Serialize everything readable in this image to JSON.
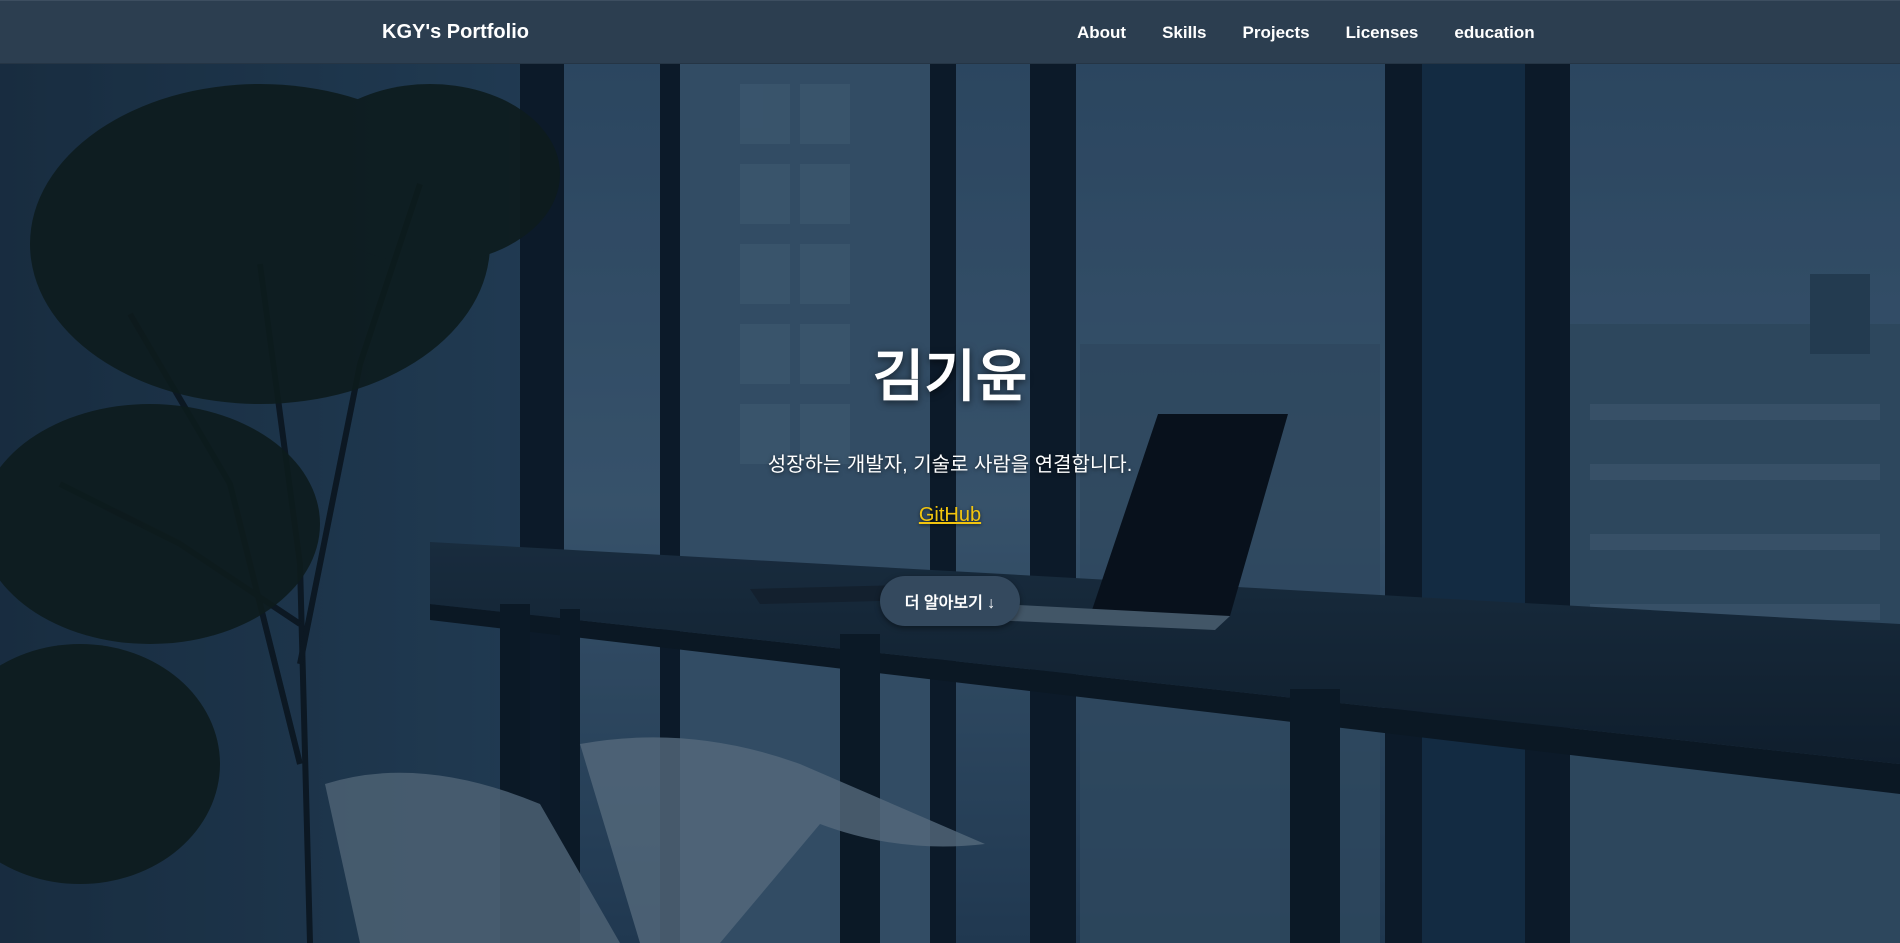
{
  "nav": {
    "brand": "KGY's Portfolio",
    "items": [
      {
        "label": "About"
      },
      {
        "label": "Skills"
      },
      {
        "label": "Projects"
      },
      {
        "label": "Licenses"
      },
      {
        "label": "education"
      }
    ]
  },
  "hero": {
    "title": "김기윤",
    "subtitle": "성장하는 개발자, 기술로 사람을 연결합니다.",
    "link_label": "GitHub",
    "button_label": "더 알아보기 ↓"
  },
  "colors": {
    "navbar": "#2c3e50",
    "accent_link": "#f1c40f",
    "button": "#34495e",
    "overlay": "#0d2035"
  }
}
